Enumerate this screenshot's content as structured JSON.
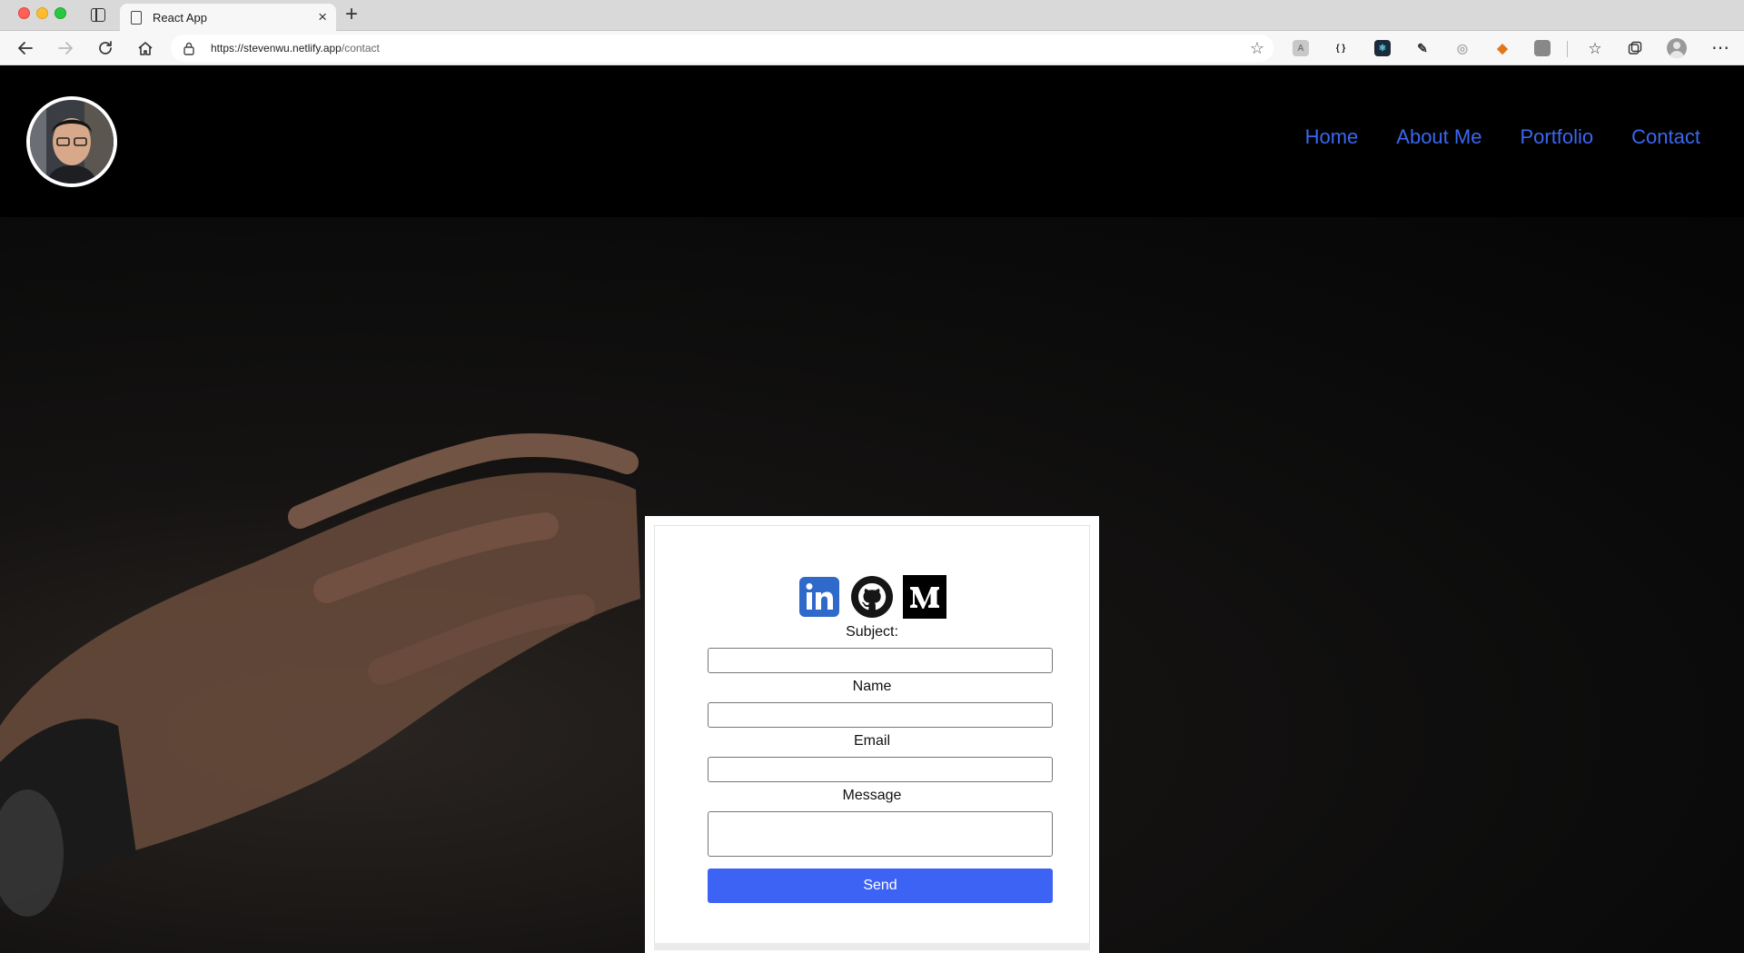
{
  "browser": {
    "tab_title": "React App",
    "url_host": "https://stevenwu.netlify.app",
    "url_path": "/contact"
  },
  "site": {
    "nav": [
      "Home",
      "About Me",
      "Portfolio",
      "Contact"
    ]
  },
  "form": {
    "subject_label": "Subject:",
    "name_label": "Name",
    "email_label": "Email",
    "message_label": "Message",
    "subject_value": "",
    "name_value": "",
    "email_value": "",
    "message_value": "",
    "send_label": "Send"
  },
  "social": [
    "linkedin",
    "github",
    "medium"
  ],
  "colors": {
    "nav_link": "#3b67f0",
    "send_button": "#3d63f5",
    "linkedin": "#2f6acb"
  }
}
